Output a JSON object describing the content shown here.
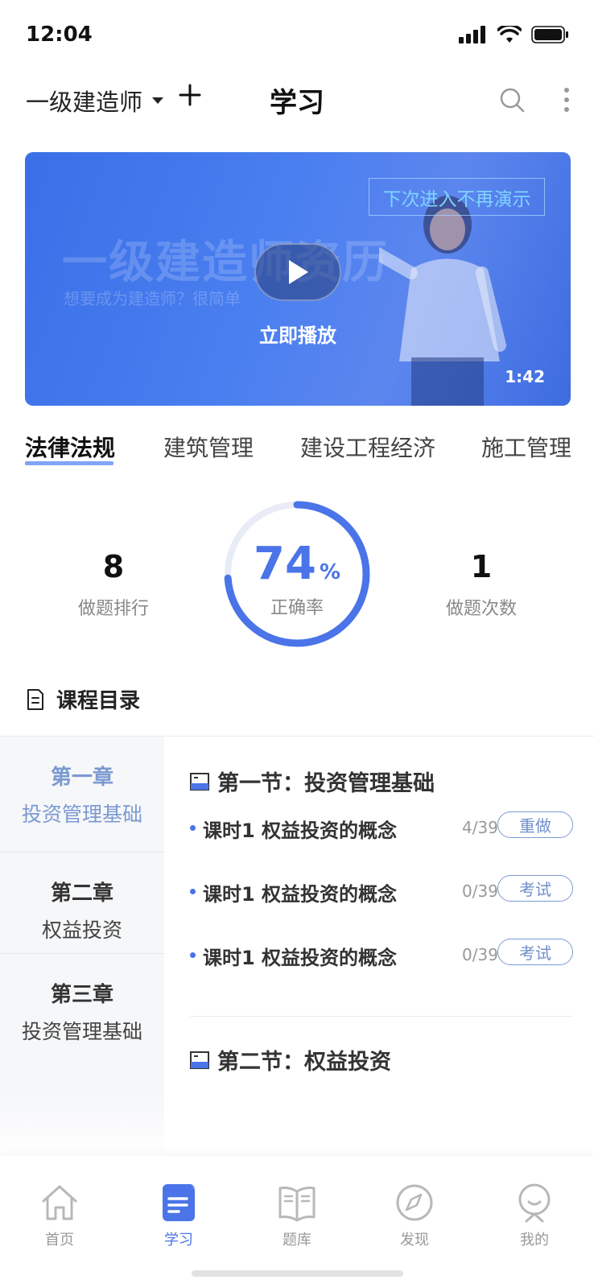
{
  "status_bar": {
    "time": "12:04"
  },
  "header": {
    "exam_selector": "一级建造师",
    "title": "学习"
  },
  "banner": {
    "background_title": "一级建造师资历",
    "background_subtitle": "想要成为建造师？很简单",
    "skip_label": "下次进入不再演示",
    "play_label": "立即播放",
    "duration": "1:42"
  },
  "tabs": [
    {
      "label": "法律法规",
      "active": true
    },
    {
      "label": "建筑管理",
      "active": false
    },
    {
      "label": "建设工程经济",
      "active": false
    },
    {
      "label": "施工管理",
      "active": false
    }
  ],
  "stats": {
    "rank": {
      "value": "8",
      "label": "做题排行"
    },
    "accuracy": {
      "value": "74",
      "unit": "%",
      "label": "正确率",
      "fraction": 0.74
    },
    "attempts": {
      "value": "1",
      "label": "做题次数"
    }
  },
  "catalog": {
    "title": "课程目录",
    "chapters": [
      {
        "number": "第一章",
        "name": "投资管理基础",
        "active": true
      },
      {
        "number": "第二章",
        "name": "权益投资",
        "active": false
      },
      {
        "number": "第三章",
        "name": "投资管理基础",
        "active": false
      }
    ],
    "sections": [
      {
        "title": "第一节：投资管理基础",
        "lessons": [
          {
            "title": "课时1 权益投资的概念",
            "progress": "4/39",
            "action": "重做"
          },
          {
            "title": "课时1 权益投资的概念",
            "progress": "0/39",
            "action": "考试"
          },
          {
            "title": "课时1 权益投资的概念",
            "progress": "0/39",
            "action": "考试"
          }
        ]
      },
      {
        "title": "第二节：权益投资",
        "lessons": []
      }
    ]
  },
  "bottom_nav": [
    {
      "label": "首页",
      "icon": "home-icon",
      "active": false
    },
    {
      "label": "学习",
      "icon": "study-icon",
      "active": true
    },
    {
      "label": "题库",
      "icon": "question-bank-icon",
      "active": false
    },
    {
      "label": "发现",
      "icon": "compass-icon",
      "active": false
    },
    {
      "label": "我的",
      "icon": "profile-icon",
      "active": false
    }
  ],
  "colors": {
    "accent": "#4a74e8",
    "chapter_active": "#7b9ad1",
    "banner": "#3a6fe8"
  }
}
